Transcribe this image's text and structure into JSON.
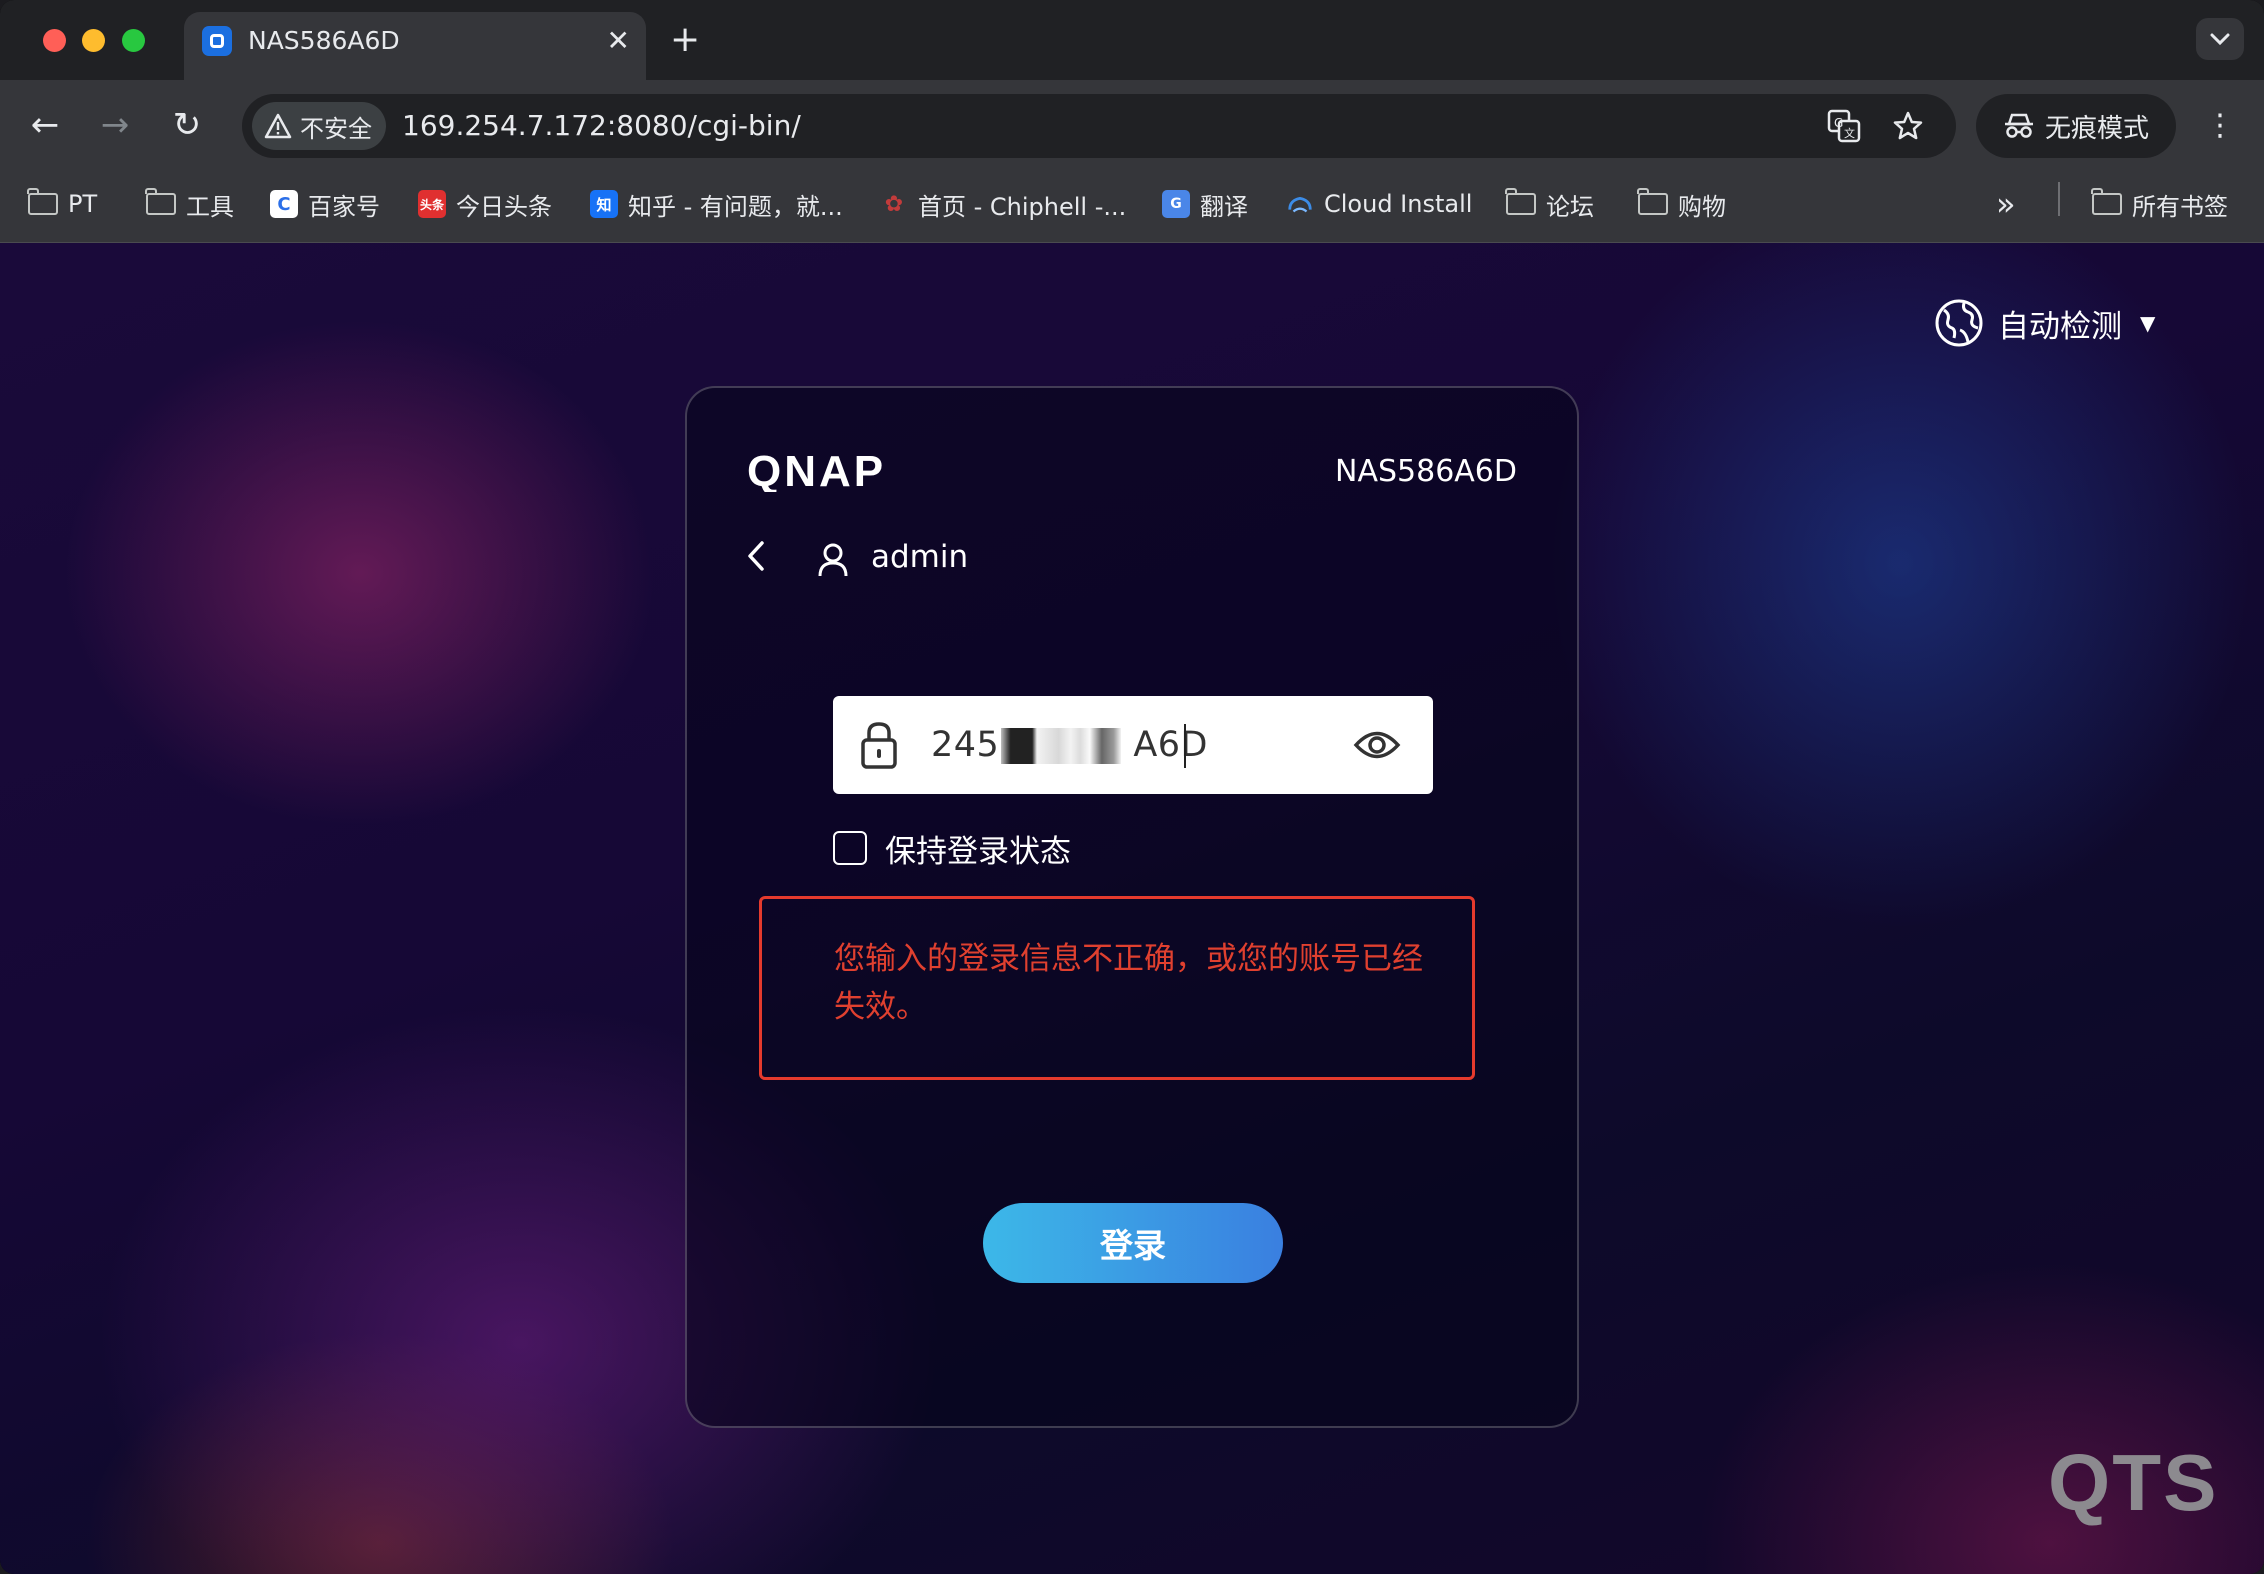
{
  "tabs": {
    "title": "NAS586A6D",
    "close": "✕",
    "new_tab": "+",
    "menu": "⌄"
  },
  "toolbar": {
    "back": "←",
    "forward": "→",
    "reload": "↻",
    "security_label": "不安全",
    "url": "169.254.7.172:8080/cgi-bin/",
    "incognito_label": "无痕模式",
    "menu": "⋮"
  },
  "bookmarks": {
    "items": [
      {
        "label": "PT",
        "icon": "folder-icon"
      },
      {
        "label": "工具",
        "icon": "folder-icon"
      },
      {
        "label": "百家号",
        "icon": "baijiahao-favicon"
      },
      {
        "label": "今日头条",
        "icon": "toutiao-favicon"
      },
      {
        "label": "知乎 - 有问题，就...",
        "icon": "zhihu-favicon"
      },
      {
        "label": "首页 - Chiphell -...",
        "icon": "chiphell-favicon"
      },
      {
        "label": "翻译",
        "icon": "translate-favicon"
      },
      {
        "label": "Cloud Install",
        "icon": "cloud-favicon"
      },
      {
        "label": "论坛",
        "icon": "folder-icon"
      },
      {
        "label": "购物",
        "icon": "folder-icon"
      }
    ],
    "overflow": "»",
    "all_bookmarks": "所有书签"
  },
  "page": {
    "language": "自动检测",
    "device_name": "NAS586A6D",
    "username": "admin",
    "password_visible_start": "245",
    "password_visible_end": "A6D",
    "remember_label": "保持登录状态",
    "error_message": "您输入的登录信息不正确，或您的账号已经失效。",
    "login_label": "登录",
    "brand_watermark": "QTS",
    "logo_text": "QNAP"
  },
  "colors": {
    "error": "#e53a2d",
    "button_start": "#3cb8e8",
    "button_end": "#3a7fe0"
  }
}
